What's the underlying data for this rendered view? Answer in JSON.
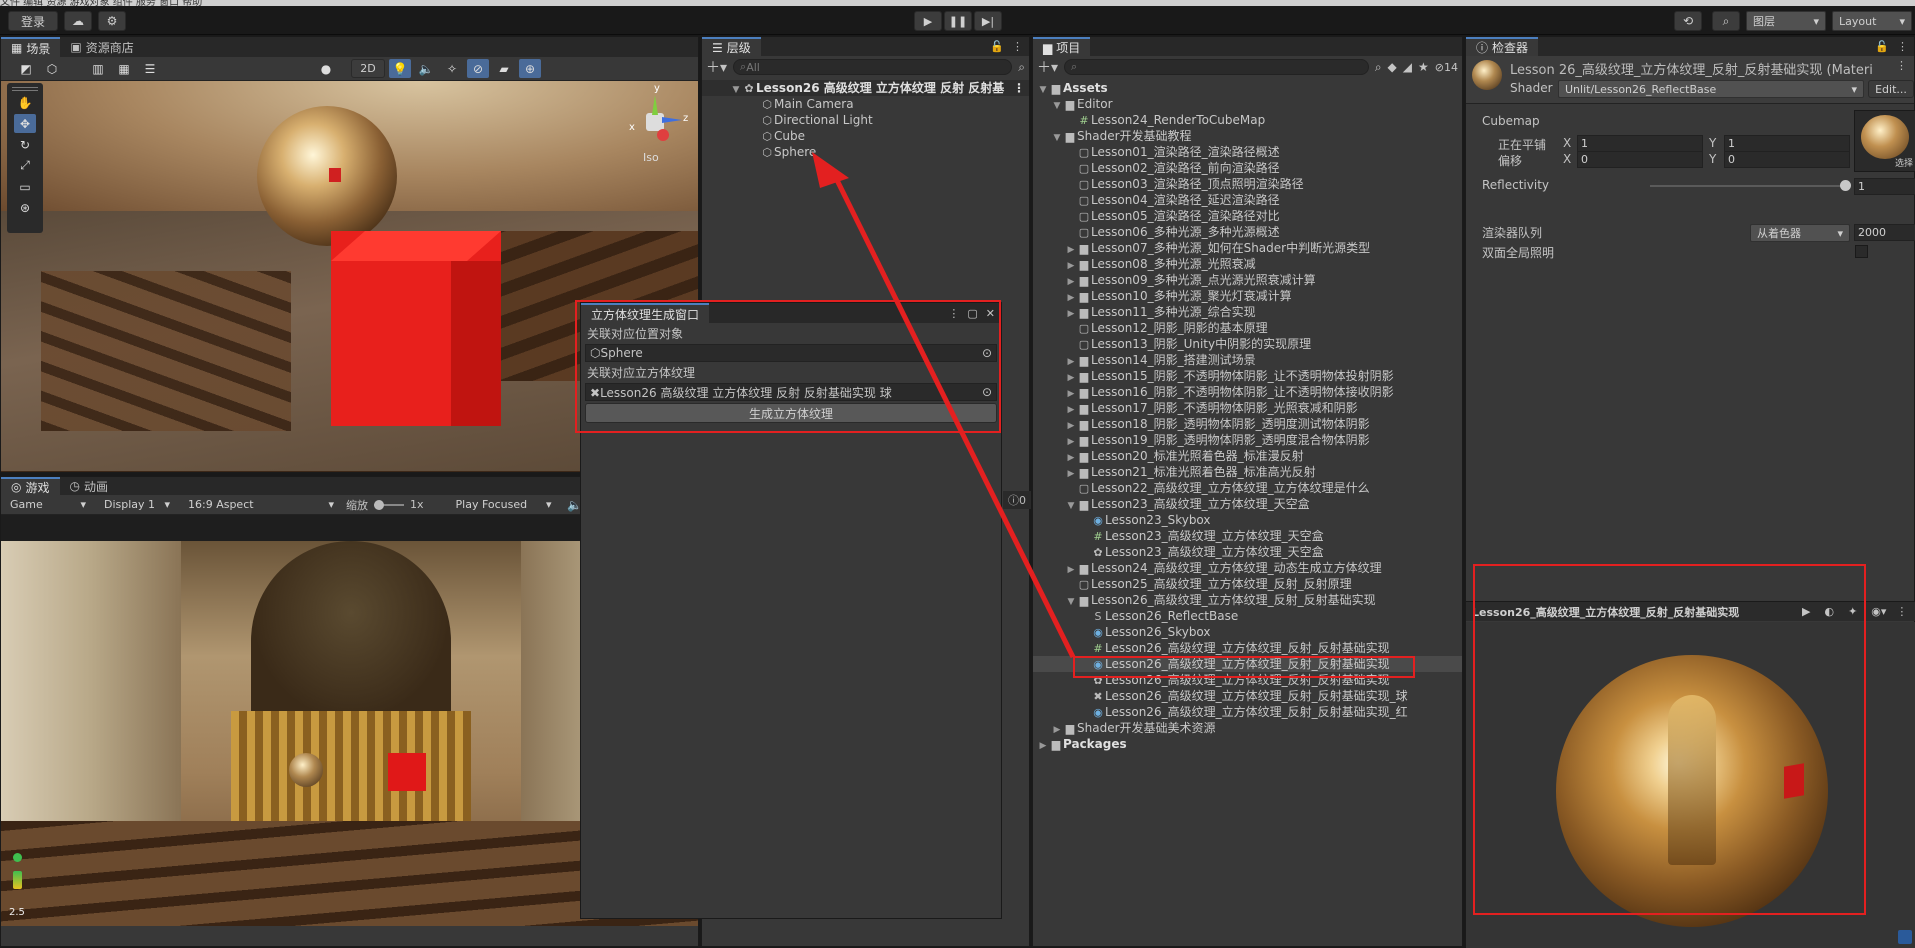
{
  "topbar": {
    "menu_strip": "文件 编辑 资源 游戏对象 组件 服务 窗口 帮助",
    "login": "登录",
    "layers_label": "图层",
    "layout_label": "Layout"
  },
  "scene": {
    "tab_scene": "场景",
    "tab_store": "资源商店",
    "mode_2d": "2D",
    "iso_label": "Iso",
    "gizmo_x": "x",
    "gizmo_y": "y",
    "gizmo_z": "z"
  },
  "game": {
    "tab_game": "游戏",
    "tab_anim": "动画",
    "game_select": "Game",
    "display_select": "Display 1",
    "aspect_select": "16:9 Aspect",
    "scale_label": "缩放",
    "scale_value": "1x",
    "play_focused": "Play Focused",
    "fps_text": "2.5",
    "count_badge": "0"
  },
  "hierarchy": {
    "tab": "层级",
    "search_placeholder": "All",
    "scene_name": "Lesson26 高级纹理 立方体纹理 反射 反射基",
    "items": [
      "Main Camera",
      "Directional Light",
      "Cube",
      "Sphere"
    ]
  },
  "tool_window": {
    "title": "立方体纹理生成窗口",
    "obj_label": "关联对应位置对象",
    "obj_value": "Sphere",
    "cube_label": "关联对应立方体纹理",
    "cube_value": "Lesson26 高级纹理 立方体纹理 反射 反射基础实现 球",
    "generate_button": "生成立方体纹理"
  },
  "project": {
    "tab": "项目",
    "hidden_count": "14",
    "tree": [
      {
        "label": "Assets",
        "indent": 0,
        "fold": "▼",
        "icon": "folder",
        "bold": true
      },
      {
        "label": "Editor",
        "indent": 1,
        "fold": "▼",
        "icon": "folder"
      },
      {
        "label": "Lesson24_RenderToCubeMap",
        "indent": 2,
        "fold": "",
        "icon": "script"
      },
      {
        "label": "Shader开发基础教程",
        "indent": 1,
        "fold": "▼",
        "icon": "folder"
      },
      {
        "label": "Lesson01_渲染路径_渲染路径概述",
        "indent": 2,
        "fold": "",
        "icon": "folder-empty"
      },
      {
        "label": "Lesson02_渲染路径_前向渲染路径",
        "indent": 2,
        "fold": "",
        "icon": "folder-empty"
      },
      {
        "label": "Lesson03_渲染路径_顶点照明渲染路径",
        "indent": 2,
        "fold": "",
        "icon": "folder-empty"
      },
      {
        "label": "Lesson04_渲染路径_延迟渲染路径",
        "indent": 2,
        "fold": "",
        "icon": "folder-empty"
      },
      {
        "label": "Lesson05_渲染路径_渲染路径对比",
        "indent": 2,
        "fold": "",
        "icon": "folder-empty"
      },
      {
        "label": "Lesson06_多种光源_多种光源概述",
        "indent": 2,
        "fold": "",
        "icon": "folder-empty"
      },
      {
        "label": "Lesson07_多种光源_如何在Shader中判断光源类型",
        "indent": 2,
        "fold": "▶",
        "icon": "folder"
      },
      {
        "label": "Lesson08_多种光源_光照衰减",
        "indent": 2,
        "fold": "▶",
        "icon": "folder"
      },
      {
        "label": "Lesson09_多种光源_点光源光照衰减计算",
        "indent": 2,
        "fold": "▶",
        "icon": "folder"
      },
      {
        "label": "Lesson10_多种光源_聚光灯衰减计算",
        "indent": 2,
        "fold": "▶",
        "icon": "folder"
      },
      {
        "label": "Lesson11_多种光源_综合实现",
        "indent": 2,
        "fold": "▶",
        "icon": "folder"
      },
      {
        "label": "Lesson12_阴影_阴影的基本原理",
        "indent": 2,
        "fold": "",
        "icon": "folder-empty"
      },
      {
        "label": "Lesson13_阴影_Unity中阴影的实现原理",
        "indent": 2,
        "fold": "",
        "icon": "folder-empty"
      },
      {
        "label": "Lesson14_阴影_搭建测试场景",
        "indent": 2,
        "fold": "▶",
        "icon": "folder"
      },
      {
        "label": "Lesson15_阴影_不透明物体阴影_让不透明物体投射阴影",
        "indent": 2,
        "fold": "▶",
        "icon": "folder"
      },
      {
        "label": "Lesson16_阴影_不透明物体阴影_让不透明物体接收阴影",
        "indent": 2,
        "fold": "▶",
        "icon": "folder"
      },
      {
        "label": "Lesson17_阴影_不透明物体阴影_光照衰减和阴影",
        "indent": 2,
        "fold": "▶",
        "icon": "folder"
      },
      {
        "label": "Lesson18_阴影_透明物体阴影_透明度测试物体阴影",
        "indent": 2,
        "fold": "▶",
        "icon": "folder"
      },
      {
        "label": "Lesson19_阴影_透明物体阴影_透明度混合物体阴影",
        "indent": 2,
        "fold": "▶",
        "icon": "folder"
      },
      {
        "label": "Lesson20_标准光照着色器_标准漫反射",
        "indent": 2,
        "fold": "▶",
        "icon": "folder"
      },
      {
        "label": "Lesson21_标准光照着色器_标准高光反射",
        "indent": 2,
        "fold": "▶",
        "icon": "folder"
      },
      {
        "label": "Lesson22_高级纹理_立方体纹理_立方体纹理是什么",
        "indent": 2,
        "fold": "",
        "icon": "folder-empty"
      },
      {
        "label": "Lesson23_高级纹理_立方体纹理_天空盒",
        "indent": 2,
        "fold": "▼",
        "icon": "folder"
      },
      {
        "label": "Lesson23_Skybox",
        "indent": 3,
        "fold": "",
        "icon": "material"
      },
      {
        "label": "Lesson23_高级纹理_立方体纹理_天空盒",
        "indent": 3,
        "fold": "",
        "icon": "script"
      },
      {
        "label": "Lesson23_高级纹理_立方体纹理_天空盒",
        "indent": 3,
        "fold": "",
        "icon": "scene"
      },
      {
        "label": "Lesson24_高级纹理_立方体纹理_动态生成立方体纹理",
        "indent": 2,
        "fold": "▶",
        "icon": "folder"
      },
      {
        "label": "Lesson25_高级纹理_立方体纹理_反射_反射原理",
        "indent": 2,
        "fold": "",
        "icon": "folder-empty"
      },
      {
        "label": "Lesson26_高级纹理_立方体纹理_反射_反射基础实现",
        "indent": 2,
        "fold": "▼",
        "icon": "folder"
      },
      {
        "label": "Lesson26_ReflectBase",
        "indent": 3,
        "fold": "",
        "icon": "shader"
      },
      {
        "label": "Lesson26_Skybox",
        "indent": 3,
        "fold": "",
        "icon": "material"
      },
      {
        "label": "Lesson26_高级纹理_立方体纹理_反射_反射基础实现",
        "indent": 3,
        "fold": "",
        "icon": "script"
      },
      {
        "label": "Lesson26_高级纹理_立方体纹理_反射_反射基础实现",
        "indent": 3,
        "fold": "",
        "icon": "material",
        "selected": true
      },
      {
        "label": "Lesson26_高级纹理_立方体纹理_反射_反射基础实现",
        "indent": 3,
        "fold": "",
        "icon": "scene"
      },
      {
        "label": "Lesson26_高级纹理_立方体纹理_反射_反射基础实现_球",
        "indent": 3,
        "fold": "",
        "icon": "cubemap"
      },
      {
        "label": "Lesson26_高级纹理_立方体纹理_反射_反射基础实现_红",
        "indent": 3,
        "fold": "",
        "icon": "material"
      },
      {
        "label": "Shader开发基础美术资源",
        "indent": 1,
        "fold": "▶",
        "icon": "folder"
      },
      {
        "label": "Packages",
        "indent": 0,
        "fold": "▶",
        "icon": "folder",
        "bold": true
      }
    ]
  },
  "inspector": {
    "tab": "检查器",
    "title": "Lesson 26_高级纹理_立方体纹理_反射_反射基础实现 (Materi",
    "shader_label": "Shader",
    "shader_value": "Unlit/Lesson26_ReflectBase",
    "edit_button": "Edit...",
    "cubemap_label": "Cubemap",
    "tiling_label": "正在平铺",
    "offset_label": "偏移",
    "x_label": "X",
    "y_label": "Y",
    "tiling_x": "1",
    "tiling_y": "1",
    "offset_x": "0",
    "offset_y": "0",
    "select_label": "选择",
    "reflectivity_label": "Reflectivity",
    "reflectivity_value": "1",
    "reflectivity": 1.0,
    "render_queue_label": "渲染器队列",
    "render_queue_select": "从着色器",
    "render_queue_value": "2000",
    "double_sided_label": "双面全局照明",
    "preview_title": "Lesson26_高级纹理_立方体纹理_反射_反射基础实现"
  },
  "colors": {
    "accent": "#4c7fbf",
    "highlight": "#e32020",
    "cube": "#e8201c"
  }
}
